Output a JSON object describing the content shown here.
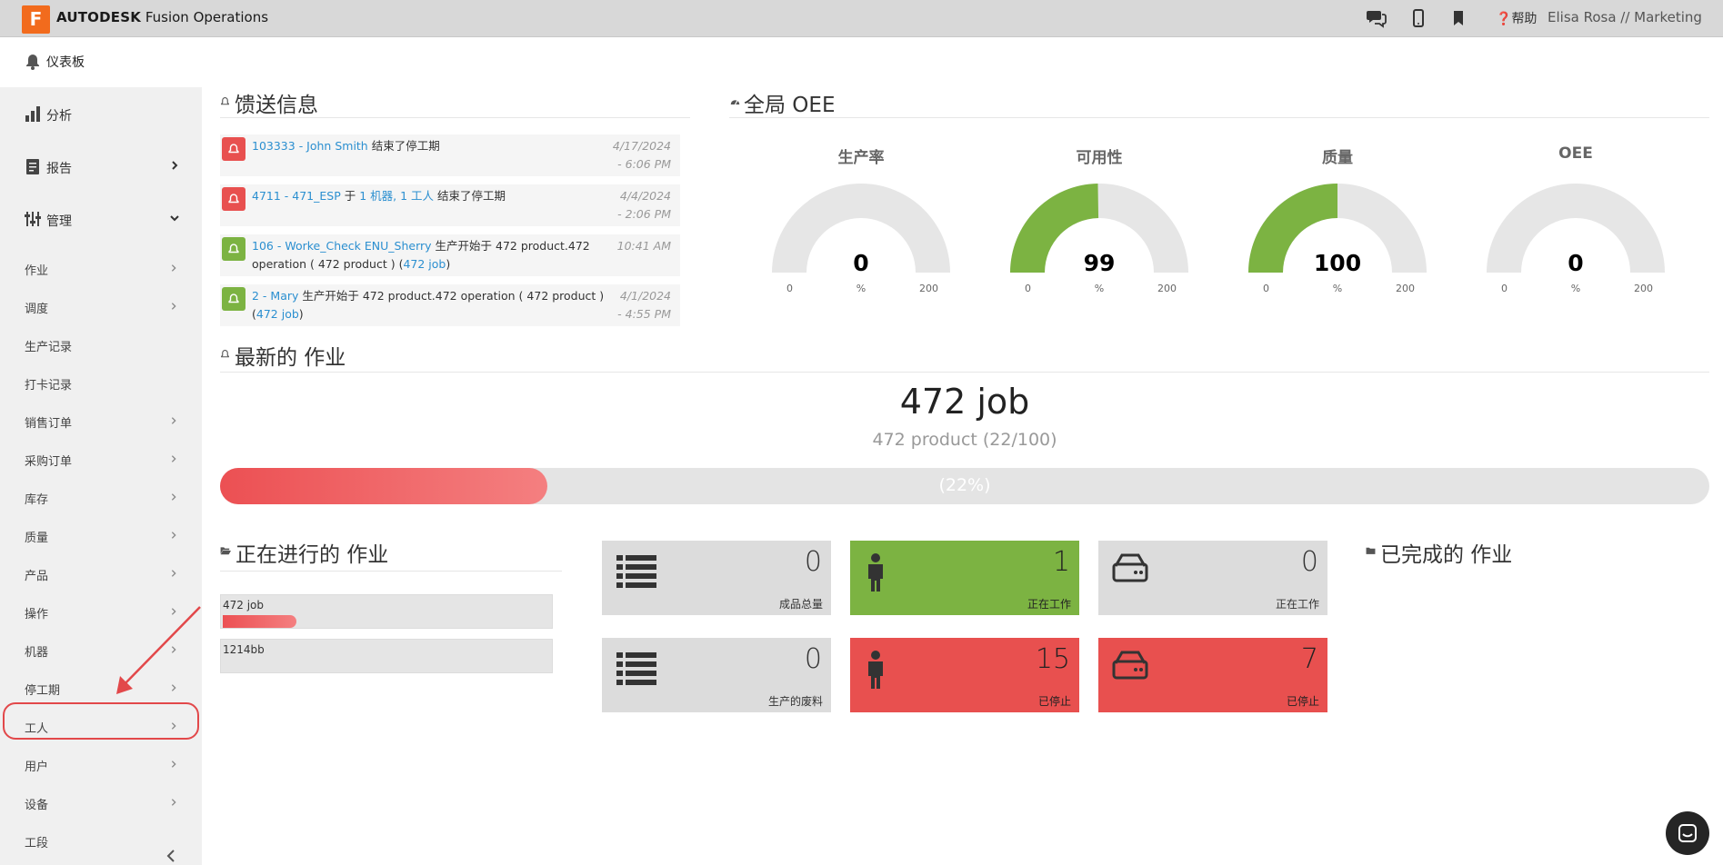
{
  "topbar": {
    "logo_letter": "F",
    "brand_bold": "AUTODESK",
    "brand_rest": " Fusion Operations",
    "help_label": "帮助",
    "user_label": "Elisa Rosa // Marketing"
  },
  "dashboard_label": "仪表板",
  "sidebar": {
    "analysis": "分析",
    "reports": "报告",
    "manage": "管理",
    "items": [
      "作业",
      "调度",
      "生产记录",
      "打卡记录",
      "销售订单",
      "采购订单",
      "库存",
      "质量",
      "产品",
      "操作",
      "机器",
      "停工期",
      "工人",
      "用户",
      "设备",
      "工段"
    ],
    "items_with_chevron": [
      true,
      true,
      false,
      false,
      true,
      true,
      true,
      true,
      true,
      true,
      true,
      true,
      true,
      true,
      true,
      false
    ]
  },
  "feed": {
    "title": "馈送信息",
    "rows": [
      {
        "status": "red",
        "link1": "103333 - John Smith",
        "text1": " 结束了停工期",
        "line2": "",
        "link2": "",
        "date1": "4/17/2024",
        "date2": "- 6:06 PM"
      },
      {
        "status": "red",
        "link1": "4711 - 471_ESP",
        "text1": " 于 ",
        "link1b": "1 机器, 1 工人",
        "text1b": " 结束了停工期",
        "line2": "",
        "link2": "",
        "date1": "4/4/2024",
        "date2": "- 2:06 PM"
      },
      {
        "status": "green",
        "link1": "106 - Worke_Check ENU_Sherry",
        "text1": " 生产开始于 472 product.472",
        "line2": "operation ( 472 product ) (",
        "link2": "472 job",
        "line2end": ")",
        "date1": "10:41 AM",
        "date2": ""
      },
      {
        "status": "green",
        "link1": "2 - Mary",
        "text1": " 生产开始于 472 product.472 operation ( 472 product )",
        "line2": "(",
        "link2": "472 job",
        "line2end": ")",
        "date1": "4/1/2024",
        "date2": "- 4:55 PM"
      }
    ]
  },
  "oee": {
    "title": "全局 OEE",
    "gauges": [
      {
        "label": "生产率",
        "value": 0,
        "min": "0",
        "max": "200",
        "unit": "%"
      },
      {
        "label": "可用性",
        "value": 99,
        "min": "0",
        "max": "200",
        "unit": "%"
      },
      {
        "label": "质量",
        "value": 100,
        "min": "0",
        "max": "200",
        "unit": "%"
      },
      {
        "label": "OEE",
        "value": 0,
        "min": "0",
        "max": "200",
        "unit": "%"
      }
    ],
    "gauge_fill_color": "#7cb342",
    "gauge_bg_color": "#e6e6e6"
  },
  "latest_job": {
    "title": "最新的 作业",
    "name": "472 job",
    "product": "472 product (22/100)",
    "progress": 0.22,
    "progress_label": "(22%)"
  },
  "in_progress": {
    "title": "正在进行的 作业",
    "jobs": [
      {
        "name": "472 job",
        "progress": 0.22
      },
      {
        "name": "1214bb",
        "progress": 0
      }
    ]
  },
  "tiles": [
    {
      "value": "0",
      "label": "成品总量",
      "icon": "list-icon",
      "bg": "#dcdcdc",
      "fg": "#333"
    },
    {
      "value": "1",
      "label": "正在工作",
      "icon": "worker-icon",
      "bg": "#7cb342",
      "fg": "#222"
    },
    {
      "value": "0",
      "label": "正在工作",
      "icon": "machine-icon",
      "bg": "#dcdcdc",
      "fg": "#333"
    },
    {
      "value": "0",
      "label": "生产的废料",
      "icon": "list-icon",
      "bg": "#dcdcdc",
      "fg": "#333"
    },
    {
      "value": "15",
      "label": "已停止",
      "icon": "worker-icon",
      "bg": "#e8504f",
      "fg": "#222"
    },
    {
      "value": "7",
      "label": "已停止",
      "icon": "machine-icon",
      "bg": "#e8504f",
      "fg": "#222"
    }
  ],
  "completed": {
    "title": "已完成的 作业"
  }
}
